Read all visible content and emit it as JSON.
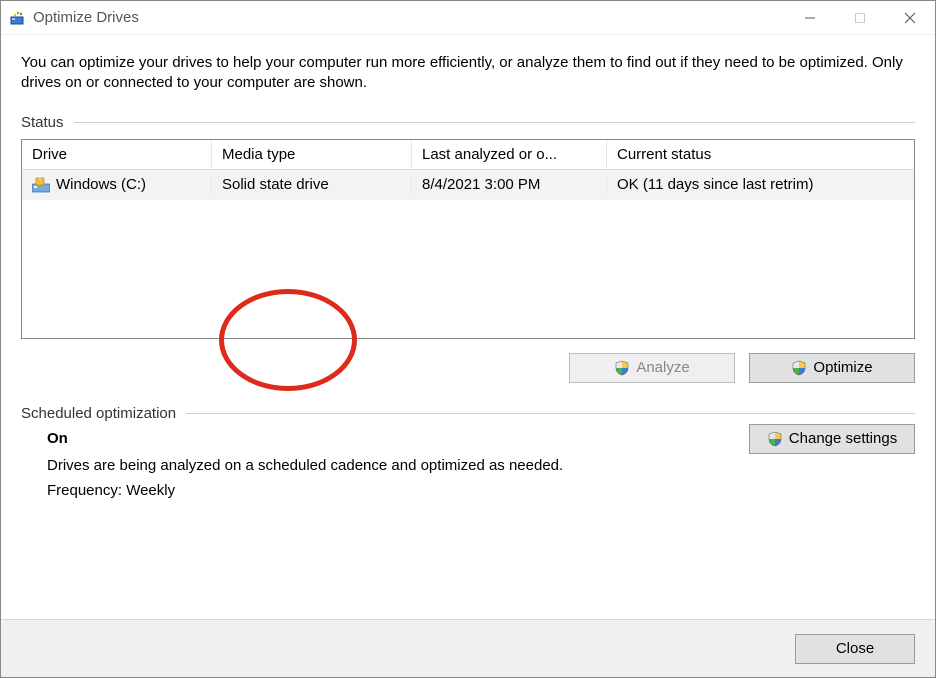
{
  "window": {
    "title": "Optimize Drives"
  },
  "intro": "You can optimize your drives to help your computer run more efficiently, or analyze them to find out if they need to be optimized. Only drives on or connected to your computer are shown.",
  "sections": {
    "status_label": "Status",
    "sched_label": "Scheduled optimization"
  },
  "drives_table": {
    "headers": {
      "drive": "Drive",
      "media": "Media type",
      "last": "Last analyzed or o...",
      "status": "Current status"
    },
    "rows": [
      {
        "drive": "Windows (C:)",
        "media": "Solid state drive",
        "last": "8/4/2021 3:00 PM",
        "status": "OK (11 days since last retrim)"
      }
    ]
  },
  "buttons": {
    "analyze": "Analyze",
    "optimize": "Optimize",
    "change_settings": "Change settings",
    "close": "Close"
  },
  "scheduled": {
    "state": "On",
    "desc": "Drives are being analyzed on a scheduled cadence and optimized as needed.",
    "frequency": "Frequency: Weekly"
  },
  "icons": {
    "app": "defrag-icon",
    "drive": "drive-icon",
    "shield": "uac-shield-icon"
  },
  "annotation": {
    "target": "media-type-cell",
    "shape": "circle",
    "color": "#dd2a1b"
  }
}
